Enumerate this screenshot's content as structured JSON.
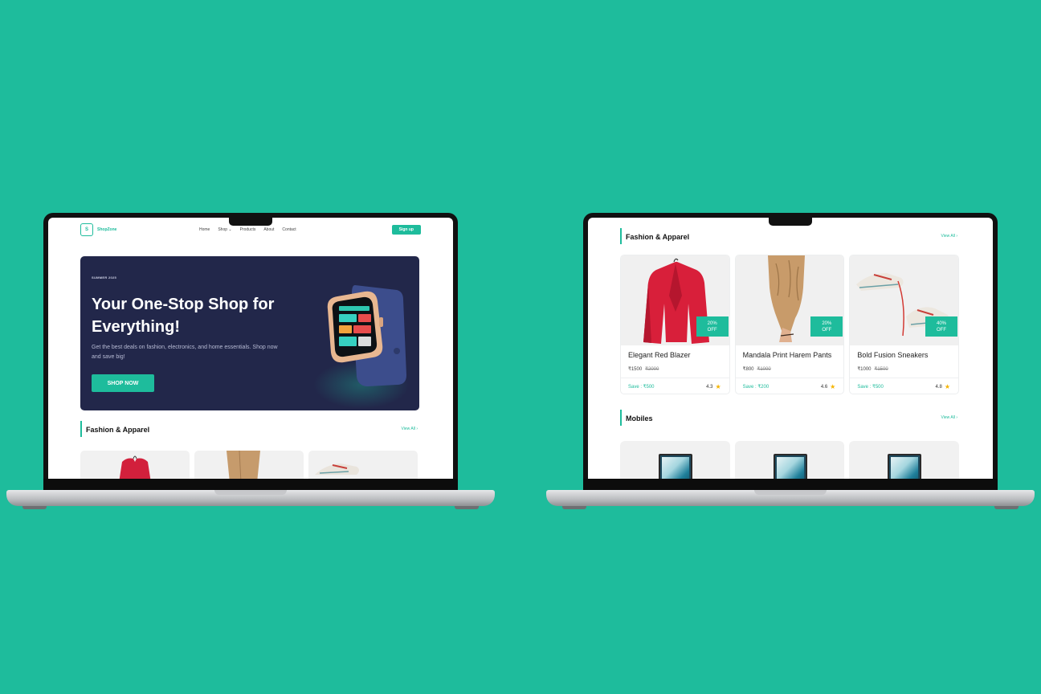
{
  "left_screen": {
    "nav": {
      "logo_text": "ShopZone",
      "logo_letter": "S",
      "menu": [
        "Home",
        "Shop ⌄",
        "Products",
        "About",
        "Contact"
      ],
      "signup_label": "Sign up"
    },
    "hero": {
      "eyebrow": "SUMMER 2025",
      "title": "Your One-Stop Shop for Everything!",
      "subtitle": "Get the best deals on fashion, electronics, and home essentials. Shop now and save big!",
      "cta_label": "SHOP NOW"
    },
    "section": {
      "title": "Fashion & Apparel",
      "view_all": "View All ›"
    }
  },
  "right_screen": {
    "section_fashion": {
      "title": "Fashion & Apparel",
      "view_all": "View All ›"
    },
    "products": [
      {
        "name": "Elegant Red Blazer",
        "price": "₹1500",
        "old_price": "₹2000",
        "discount_value": "20%",
        "discount_label": "OFF",
        "save": "Save : ₹500",
        "rating": "4.3"
      },
      {
        "name": "Mandala Print Harem Pants",
        "price": "₹800",
        "old_price": "₹1000",
        "discount_value": "20%",
        "discount_label": "OFF",
        "save": "Save : ₹200",
        "rating": "4.6"
      },
      {
        "name": "Bold Fusion Sneakers",
        "price": "₹1000",
        "old_price": "₹1500",
        "discount_value": "40%",
        "discount_label": "OFF",
        "save": "Save : ₹500",
        "rating": "4.8"
      }
    ],
    "section_mobiles": {
      "title": "Mobiles",
      "view_all": "View All ›"
    }
  },
  "colors": {
    "background": "#1ebc9c",
    "accent": "#1ebc9c",
    "hero_bg": "#22274a",
    "star": "#f5b400"
  }
}
